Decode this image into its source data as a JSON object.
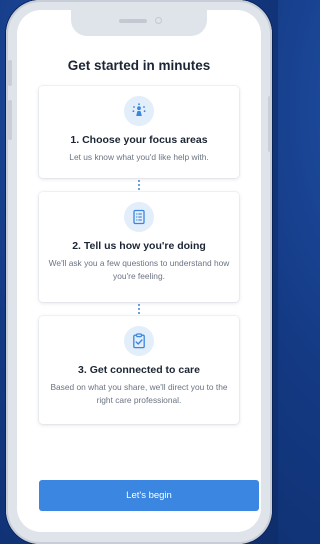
{
  "header": {
    "title": "Get started in minutes"
  },
  "steps": [
    {
      "icon": "focus-areas-icon",
      "title": "1. Choose your focus areas",
      "description": "Let us know what you'd like help with."
    },
    {
      "icon": "questionnaire-icon",
      "title": "2. Tell us how you're doing",
      "description": "We'll ask you a few questions to understand how you're feeling."
    },
    {
      "icon": "clipboard-check-icon",
      "title": "3. Get connected to care",
      "description": "Based on what you share, we'll direct you to the right care professional."
    }
  ],
  "cta": {
    "label": "Let's begin"
  },
  "colors": {
    "background": "#143a84",
    "accent": "#3a86e0",
    "icon_bg": "#e3eefb",
    "title_text": "#1c2533",
    "body_text": "#6b7382"
  }
}
